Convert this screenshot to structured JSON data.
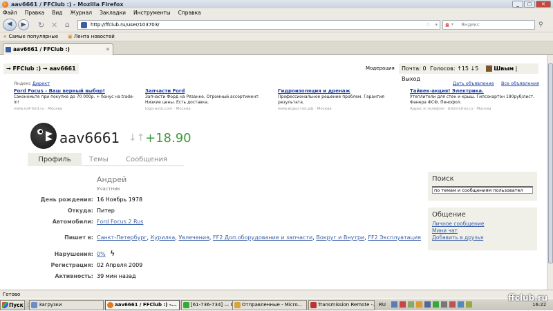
{
  "window": {
    "title": "aav6661 / FFClub :) - Mozilla Firefox"
  },
  "menu": [
    "Файл",
    "Правка",
    "Вид",
    "Журнал",
    "Закладки",
    "Инструменты",
    "Справка"
  ],
  "nav": {
    "url": "http://ffclub.ru/user/103703/",
    "search_placeholder": "Яндекс"
  },
  "bookmarks": [
    "Самые популярные",
    "Лента новостей"
  ],
  "tab": {
    "label": "aav6661 / FFClub :)"
  },
  "page": {
    "breadcrumb": "→ FFClub :) → aav6661",
    "moderation": "Модерация",
    "mail": "Почта: 0",
    "votes": "Голосов: ↑15 ↓5",
    "user_short": "Швым",
    "logout": "Выход",
    "yad": {
      "label": "Яндекс",
      "link": "Директ",
      "give_ad": "Дать объявление",
      "all_ads": "Все объявления"
    },
    "ads": [
      {
        "title": "Ford Focus - Ваш верный выбор!",
        "desc": "Сэкономьте при покупке до 70 000р. + бонус на trade-in!",
        "url": "www.rolf-ford.ru · Москва"
      },
      {
        "title": "Запчасти Ford",
        "desc": "Запчасти Форд на Рязанке. Огромный ассортимент. Низкие цены. Есть доставка.",
        "url": "logo-avto.com · Москва"
      },
      {
        "title": "Гидроизоляция и дренаж",
        "desc": "Профессиональное решение проблем. Гарантия результата.",
        "url": "www.водосток.рф · Москва"
      },
      {
        "title": "Тайвек-акция! Электрика.",
        "desc": "Утеплители для стен и крыш. Гипсокартон 190руб/лист. Фанера ФСФ. Пенофол.",
        "url": "Адрес и телефон · bdomstroy.ru · Москва"
      }
    ],
    "nickname": "aav6661",
    "rating": "+18.90",
    "rating_arrows": "↓↑",
    "profile_tabs": [
      "Профиль",
      "Темы",
      "Сообщения"
    ],
    "real_name": "Андрей",
    "role": "Участник",
    "fields": {
      "birthday_label": "День рождения:",
      "birthday": "16 Ноябрь 1978",
      "from_label": "Откуда:",
      "from": "Питер",
      "car_label": "Автомобили:",
      "car": "Ford Focus 2 Rus",
      "writes_label": "Пишет в:",
      "writes": [
        "Санкт-Петербург",
        "Курилка",
        "Увлечения",
        "FF2 Доп.оборудование и запчасти",
        "Вокруг и Внутри",
        "FF2 Эксплуатация"
      ],
      "violations_label": "Нарушения:",
      "violations": "0%",
      "reg_label": "Регистрация:",
      "reg": "02 Апреля 2009",
      "activity_label": "Активность:",
      "activity": "39 мин назад"
    },
    "sidebar": {
      "search_title": "Поиск",
      "search_placeholder": "по темам и сообщениям пользовател",
      "comm_title": "Общение",
      "links": [
        "Личное сообщение",
        "Мини чат",
        "Добавить в друзья"
      ]
    }
  },
  "status": "Готово",
  "taskbar": {
    "start": "Пуск",
    "items": [
      "Загрузки",
      "aav6661 / FFClub :) -...",
      "[61-736-734] — Окно со...",
      "Отправленные - Micro...",
      "Transmission Remote -..."
    ],
    "lang": "RU",
    "time": "16:22"
  },
  "watermark": "ffclub.ru"
}
